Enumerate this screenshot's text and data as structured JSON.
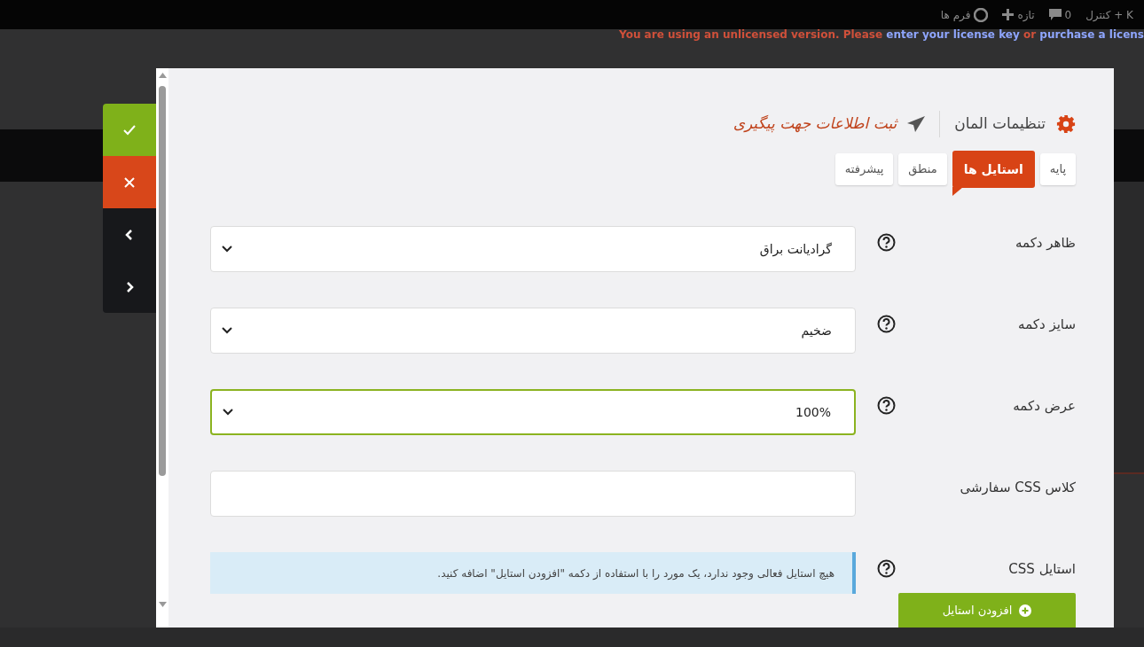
{
  "admin_bar": {
    "items": [
      {
        "kind": "shortcut",
        "label": "کنترل + K"
      },
      {
        "kind": "comments",
        "label": "0"
      },
      {
        "kind": "new",
        "label": "تازه"
      },
      {
        "kind": "forms",
        "label": "فرم ها"
      }
    ]
  },
  "license_notice": {
    "text": "You are using an unlicensed version. Please ",
    "link_1": "enter your license key",
    "middle": " or ",
    "link_2": "purchase a licens"
  },
  "side_actions": [
    {
      "kind": "confirm"
    },
    {
      "kind": "cancel"
    },
    {
      "kind": "prev"
    },
    {
      "kind": "next"
    }
  ],
  "modal": {
    "heading": "تنظیمات المان",
    "element_title": "ثبت اطلاعات جهت پیگیری",
    "tabs": [
      {
        "label": "پایه",
        "selected": false
      },
      {
        "label": "استایل ها",
        "selected": true
      },
      {
        "label": "منطق",
        "selected": false
      },
      {
        "label": "پیشرفته",
        "selected": false
      }
    ],
    "fields": [
      {
        "kind": "select",
        "label": "ظاهر دکمه",
        "help": true,
        "value": "گرادیانت براق",
        "focused": false
      },
      {
        "kind": "select",
        "label": "سایز دکمه",
        "help": true,
        "value": "ضخیم",
        "focused": false
      },
      {
        "kind": "select",
        "label": "عرض دکمه",
        "help": true,
        "value": "100%",
        "focused": true
      },
      {
        "kind": "text",
        "label": "کلاس CSS سفارشی",
        "help": false,
        "focused": false
      },
      {
        "kind": "styles",
        "label": "استایل CSS",
        "help": true,
        "notice": "هیچ استایل فعالی وجود ندارد، یک مورد را با استفاده از دکمه \"افزودن استایل\" اضافه کنید.",
        "button": "افزودن استایل"
      }
    ]
  }
}
